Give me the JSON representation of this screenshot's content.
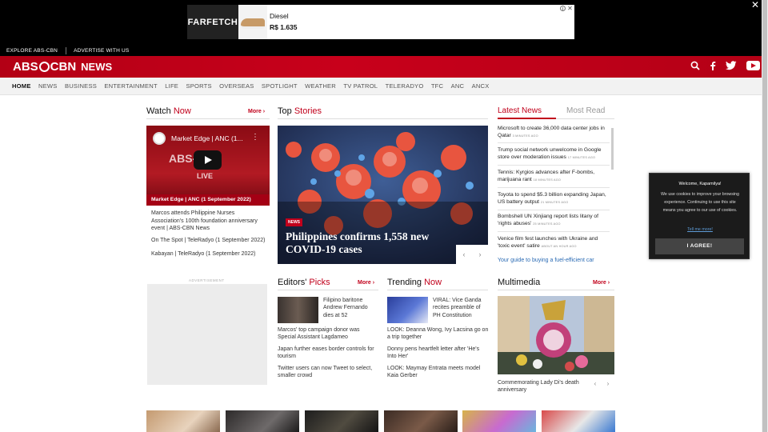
{
  "ad": {
    "brand": "FARFETCH",
    "product": "Diesel",
    "price": "R$ 1.635",
    "info_icon": "i",
    "close_icon": "✕"
  },
  "page_close": "✕",
  "utility": {
    "explore": "EXPLORE ABS-CBN",
    "advertise": "ADVERTISE WITH US"
  },
  "header": {
    "logo_left": "ABS",
    "logo_right": "CBN",
    "logo_news": "NEWS",
    "icons": [
      "search-icon",
      "facebook-icon",
      "twitter-icon",
      "youtube-icon"
    ]
  },
  "nav": {
    "items": [
      "HOME",
      "NEWS",
      "BUSINESS",
      "ENTERTAINMENT",
      "LIFE",
      "SPORTS",
      "OVERSEAS",
      "SPOTLIGHT",
      "WEATHER",
      "TV PATROL",
      "TELERADYO",
      "TFC",
      "ANC",
      "ANCX"
    ]
  },
  "watch": {
    "title_a": "Watch",
    "title_b": "Now",
    "more": "More",
    "video_title": "Market Edge | ANC (1...",
    "video_watermark": "ABS-CBN",
    "video_live": "LIVE",
    "caption": "Market Edge | ANC (1 September 2022)",
    "items": [
      "Marcos attends Philippine Nurses Association's 100th foundation anniversary event | ABS-CBN News",
      "On The Spot | TeleRadyo (1 September 2022)",
      "Kabayan | TeleRadyo (1 September 2022)"
    ],
    "ad_label": "ADVERTISEMENT"
  },
  "top": {
    "title_a": "Top",
    "title_b": "Stories",
    "tag": "NEWS",
    "headline": "Philippines confirms 1,558 new COVID-19 cases",
    "prev": "‹",
    "next": "›"
  },
  "latest": {
    "tab_active": "Latest News",
    "tab_inactive": "Most Read",
    "items": [
      {
        "text": "Microsoft to create 36,000 data center jobs in Qatar",
        "ago": "3 MINUTES AGO"
      },
      {
        "text": "Trump social network unwelcome in Google store over moderation issues",
        "ago": "17 MINUTES AGO"
      },
      {
        "text": "Tennis: Kyrgios advances after F-bombs, marijuana rant",
        "ago": "18 MINUTES AGO"
      },
      {
        "text": "Toyota to spend $5.3 billion expanding Japan, US battery output",
        "ago": "21 MINUTES AGO"
      },
      {
        "text": "Bombshell UN Xinjiang report lists litany of 'rights abuses'",
        "ago": "25 MINUTES AGO"
      },
      {
        "text": "Venice film fest launches with Ukraine and 'toxic event' satire",
        "ago": "ABOUT AN HOUR AGO"
      }
    ],
    "guide": "Your guide to buying a fuel-efficient car"
  },
  "editors": {
    "title_a": "Editors'",
    "title_b": "Picks",
    "more": "More",
    "lead": "Filipino baritone Andrew Fernando dies at 52",
    "items": [
      "Marcos' top campaign donor was Special Assistant Lagdameo",
      "Japan further eases border controls for tourism",
      "Twitter users can now Tweet to select, smaller crowd"
    ]
  },
  "trending": {
    "title_a": "Trending",
    "title_b": "Now",
    "lead": "VIRAL: Vice Ganda recites preamble of PH Constitution",
    "items": [
      "LOOK: Deanna Wong, Ivy Lacsina go on a trip together",
      "Donny pens heartfelt letter after 'He's Into Her'",
      "LOOK: Maymay Entrata meets model Kaia Gerber"
    ]
  },
  "multimedia": {
    "title": "Multimedia",
    "more": "More",
    "caption": "Commemorating Lady Di's death anniversary",
    "prev": "‹",
    "next": "›"
  },
  "cookie": {
    "title": "Welcome, Kapamilya!",
    "body": "We use cookies to improve your browsing experience. Continuing to use this site means you agree to our use of cookies.",
    "link": "Tell me more!",
    "button": "I AGREE!"
  },
  "colors": {
    "brand_red": "#c1001b",
    "link_blue": "#2b6bb4"
  }
}
